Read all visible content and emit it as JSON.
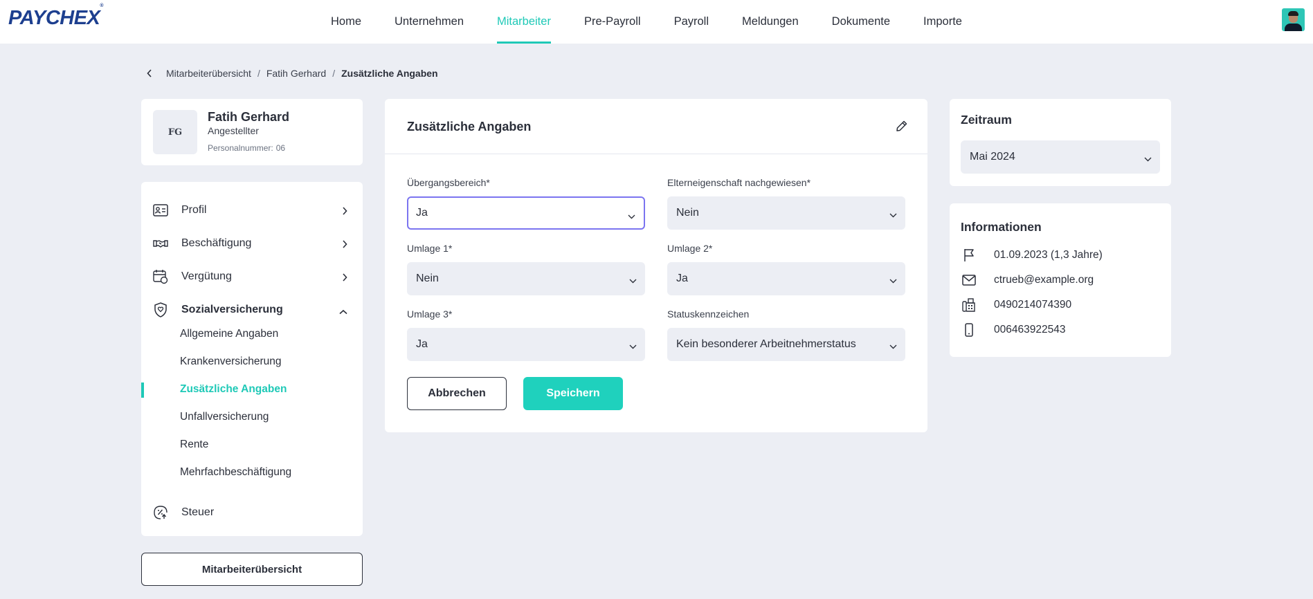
{
  "header": {
    "logo": "PAYCHEX",
    "nav": [
      "Home",
      "Unternehmen",
      "Mitarbeiter",
      "Pre-Payroll",
      "Payroll",
      "Meldungen",
      "Dokumente",
      "Importe"
    ],
    "active_nav": "Mitarbeiter"
  },
  "breadcrumb": {
    "items": [
      "Mitarbeiterübersicht",
      "Fatih Gerhard",
      "Zusätzliche Angaben"
    ],
    "separator": "/"
  },
  "employee": {
    "initials": "FG",
    "name": "Fatih Gerhard",
    "role": "Angestellter",
    "personnel_label": "Personalnummer:",
    "personnel_number": "06"
  },
  "sidebar": {
    "items": [
      {
        "label": "Profil",
        "icon": "profile-card-icon"
      },
      {
        "label": "Beschäftigung",
        "icon": "handshake-icon"
      },
      {
        "label": "Vergütung",
        "icon": "calendar-money-icon"
      },
      {
        "label": "Sozialversicherung",
        "icon": "shield-icon",
        "expanded": true
      },
      {
        "label": "Steuer",
        "icon": "tax-icon"
      }
    ],
    "sub_items": [
      "Allgemeine Angaben",
      "Krankenversicherung",
      "Zusätzliche Angaben",
      "Unfallversicherung",
      "Rente",
      "Mehrfachbeschäftigung"
    ],
    "active_sub": "Zusätzliche Angaben",
    "overview_button": "Mitarbeiterübersicht"
  },
  "form": {
    "title": "Zusätzliche Angaben",
    "fields": [
      {
        "label": "Übergangsbereich*",
        "value": "Ja"
      },
      {
        "label": "Elterneigenschaft nachgewiesen*",
        "value": "Nein"
      },
      {
        "label": "Umlage 1*",
        "value": "Nein"
      },
      {
        "label": "Umlage 2*",
        "value": "Ja"
      },
      {
        "label": "Umlage 3*",
        "value": "Ja"
      },
      {
        "label": "Statuskennzeichen",
        "value": "Kein besonderer Arbeitnehmerstatus"
      }
    ],
    "cancel_label": "Abbrechen",
    "save_label": "Speichern"
  },
  "zeitraum": {
    "title": "Zeitraum",
    "value": "Mai 2024"
  },
  "informationen": {
    "title": "Informationen",
    "rows": [
      {
        "icon": "flag-icon",
        "text": "01.09.2023 (1,3 Jahre)"
      },
      {
        "icon": "mail-icon",
        "text": "ctrueb@example.org"
      },
      {
        "icon": "phone-icon",
        "text": "0490214074390"
      },
      {
        "icon": "mobile-icon",
        "text": "006463922543"
      }
    ]
  },
  "colors": {
    "accent": "#1fc9b7",
    "button_primary": "#1fd1bd",
    "background": "#eceef4",
    "focus_border": "#7b74f0",
    "logo": "#1d3f8f"
  }
}
